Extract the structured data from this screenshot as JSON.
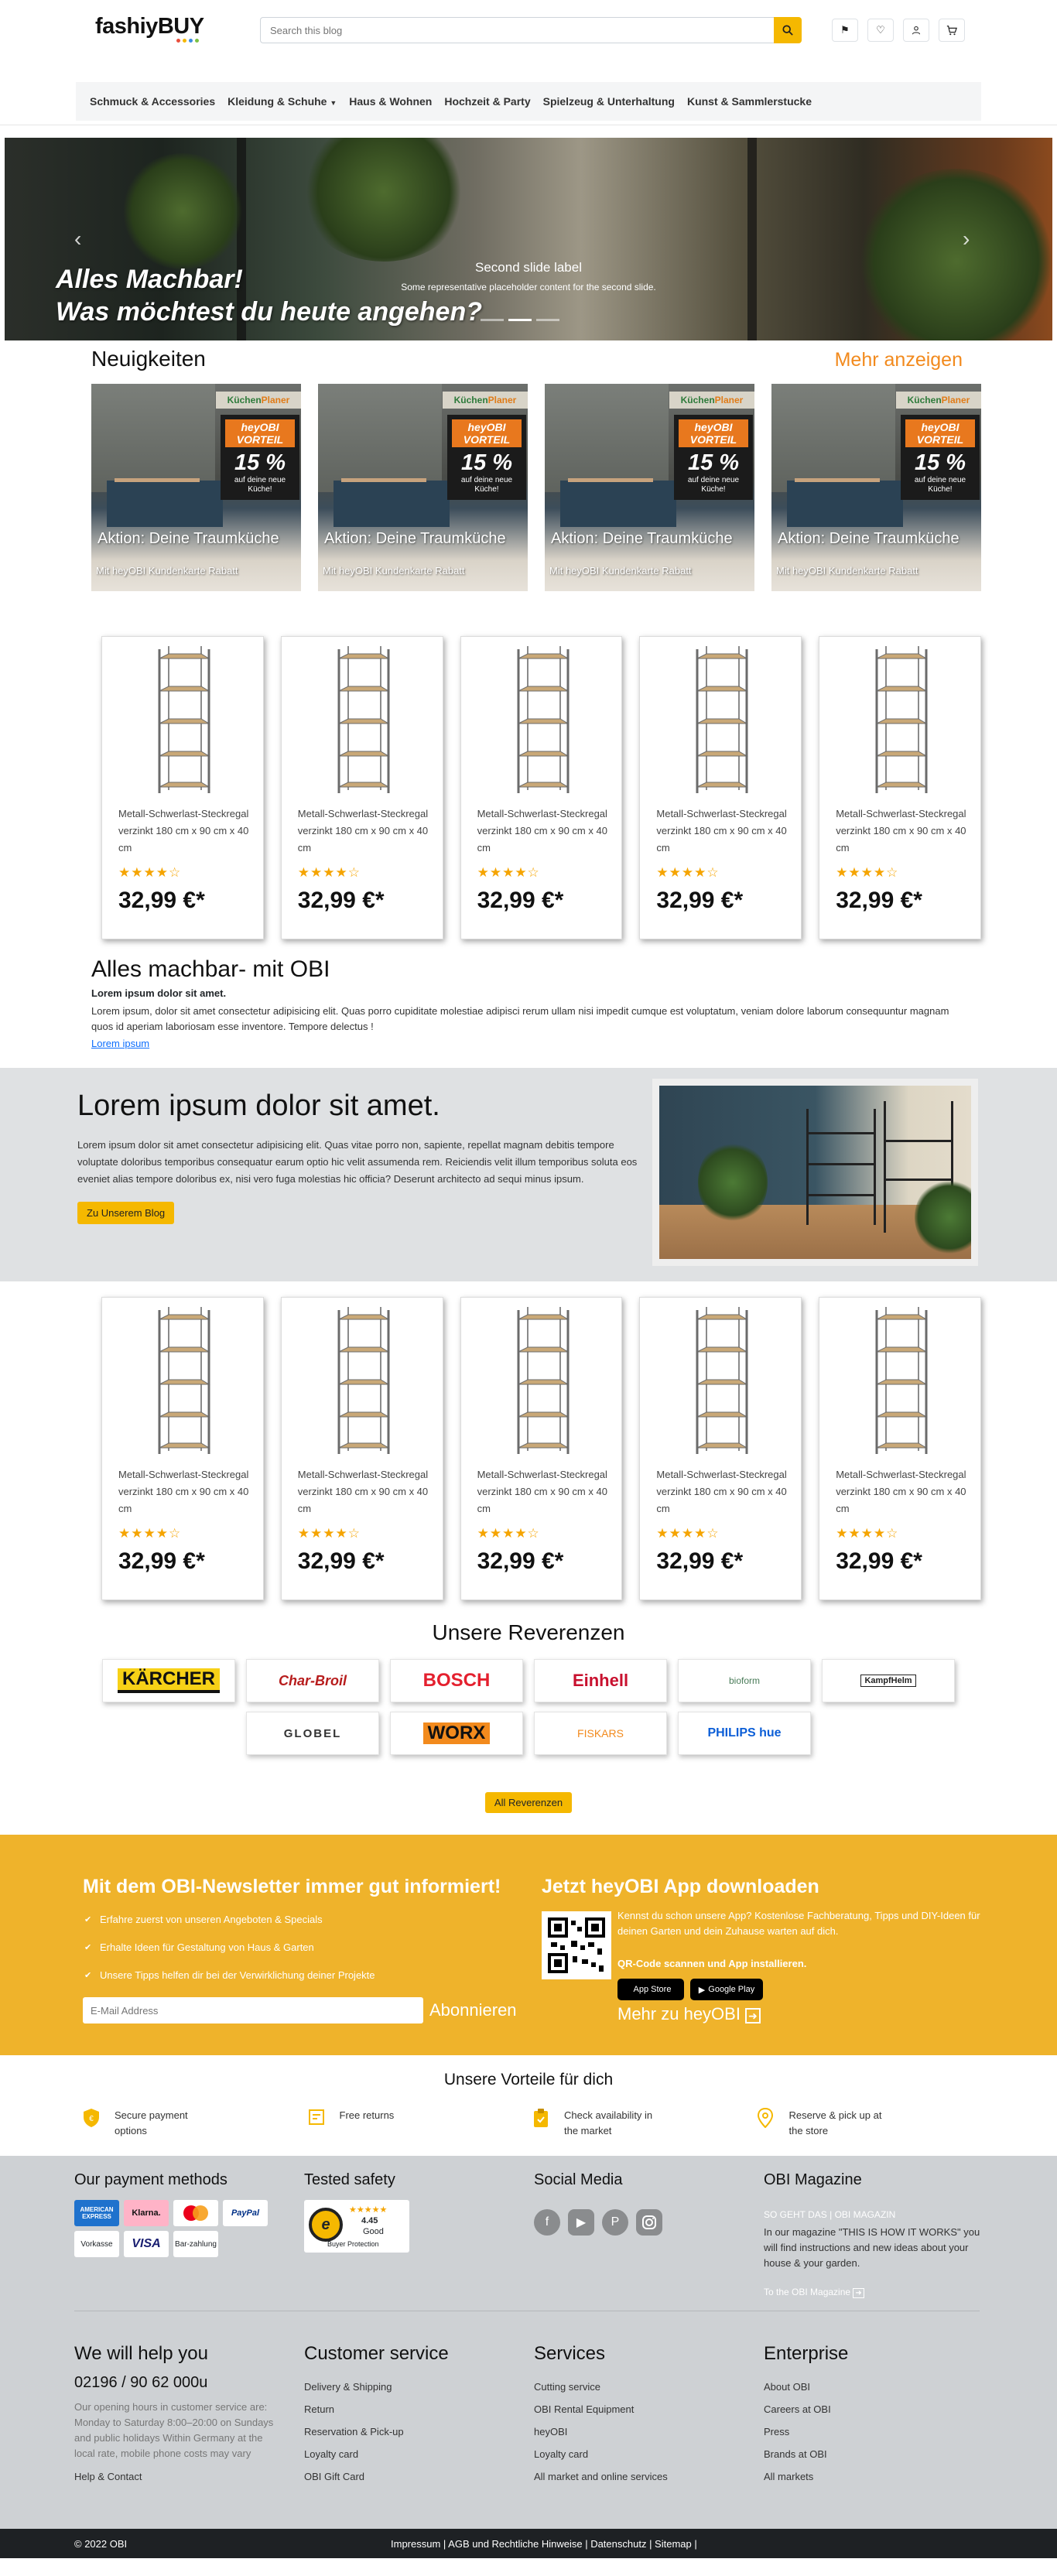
{
  "header": {
    "logo": "fashiyBUY",
    "logo_dot_colors": [
      "#e94e3c",
      "#f5b800",
      "#3a8de0",
      "#7bc043"
    ],
    "search": {
      "placeholder": "Search this blog"
    },
    "icons": [
      "search-icon",
      "flag-icon",
      "heart-icon",
      "user-icon",
      "cart-icon"
    ]
  },
  "nav": {
    "items": [
      "Schmuck & Accessories",
      "Kleidung & Schuhe",
      "Haus & Wohnen",
      "Hochzeit & Party",
      "Spielzeug & Unterhaltung",
      "Kunst & Sammlerstucke"
    ]
  },
  "hero": {
    "title_line1": "Alles Machbar!",
    "title_line2": "Was möchtest du heute angehen?",
    "caption_title": "Second slide label",
    "caption_text": "Some representative placeholder content for the second slide.",
    "slide_count": 3,
    "active_slide": 2
  },
  "news": {
    "title": "Neuigkeiten",
    "more": "Mehr anzeigen",
    "cards": [
      {
        "tag1": "Küchen",
        "tag2": "Planer",
        "badge_a": "heyOBI",
        "badge_b": "VORTEIL",
        "pct": "15 %",
        "badge_small1": "auf deine neue",
        "badge_small2": "Küche!",
        "title": "Aktion: Deine Traumküche",
        "sub": "Mit heyOBI Kundenkarte Rabatt"
      },
      {
        "tag1": "Küchen",
        "tag2": "Planer",
        "badge_a": "heyOBI",
        "badge_b": "VORTEIL",
        "pct": "15 %",
        "badge_small1": "auf deine neue",
        "badge_small2": "Küche!",
        "title": "Aktion: Deine Traumküche",
        "sub": "Mit heyOBI Kundenkarte Rabatt"
      },
      {
        "tag1": "Küchen",
        "tag2": "Planer",
        "badge_a": "heyOBI",
        "badge_b": "VORTEIL",
        "pct": "15 %",
        "badge_small1": "auf deine neue",
        "badge_small2": "Küche!",
        "title": "Aktion: Deine Traumküche",
        "sub": "Mit heyOBI Kundenkarte Rabatt"
      },
      {
        "tag1": "Küchen",
        "tag2": "Planer",
        "badge_a": "heyOBI",
        "badge_b": "VORTEIL",
        "pct": "15 %",
        "badge_small1": "auf deine neue",
        "badge_small2": "Küche!",
        "title": "Aktion: Deine Traumküche",
        "sub": "Mit heyOBI Kundenkarte Rabatt"
      }
    ]
  },
  "products1": [
    {
      "name": "Metall-Schwerlast-Steckregal verzinkt 180 cm x 90 cm x 40 cm",
      "stars": "★★★★☆",
      "rating": 4.5,
      "price": "32,99 €*"
    },
    {
      "name": "Metall-Schwerlast-Steckregal verzinkt 180 cm x 90 cm x 40 cm",
      "stars": "★★★★☆",
      "rating": 4.5,
      "price": "32,99 €*"
    },
    {
      "name": "Metall-Schwerlast-Steckregal verzinkt 180 cm x 90 cm x 40 cm",
      "stars": "★★★★☆",
      "rating": 4.5,
      "price": "32,99 €*"
    },
    {
      "name": "Metall-Schwerlast-Steckregal verzinkt 180 cm x 90 cm x 40 cm",
      "stars": "★★★★☆",
      "rating": 4.5,
      "price": "32,99 €*"
    },
    {
      "name": "Metall-Schwerlast-Steckregal verzinkt 180 cm x 90 cm x 40 cm",
      "stars": "★★★★☆",
      "rating": 4.5,
      "price": "32,99 €*"
    }
  ],
  "intro": {
    "title": "Alles machbar- mit OBI",
    "lead": "Lorem ipsum dolor sit amet.",
    "text": "Lorem ipsum, dolor sit amet consectetur adipisicing elit. Quas porro cupiditate molestiae adipisci rerum ullam nisi impedit cumque est voluptatum, veniam dolore laborum consequuntur magnam quos id aperiam laboriosam esse inventore. Tempore delectus !",
    "link": "Lorem ipsum"
  },
  "blog": {
    "title": "Lorem ipsum dolor sit amet.",
    "text": "Lorem ipsum dolor sit amet consectetur adipisicing elit. Quas vitae porro non, sapiente, repellat magnam debitis tempore voluptate doloribus temporibus consequatur earum optio hic velit assumenda rem. Reiciendis velit illum temporibus soluta eos eveniet alias tempore doloribus ex, nisi vero fuga molestias hic officia? Deserunt architecto ad sequi minus ipsum.",
    "button": "Zu Unserem Blog"
  },
  "products2": [
    {
      "name": "Metall-Schwerlast-Steckregal verzinkt 180 cm x 90 cm x 40 cm",
      "stars": "★★★★☆",
      "rating": 4.5,
      "price": "32,99 €*"
    },
    {
      "name": "Metall-Schwerlast-Steckregal verzinkt 180 cm x 90 cm x 40 cm",
      "stars": "★★★★☆",
      "rating": 4.5,
      "price": "32,99 €*"
    },
    {
      "name": "Metall-Schwerlast-Steckregal verzinkt 180 cm x 90 cm x 40 cm",
      "stars": "★★★★☆",
      "rating": 4.5,
      "price": "32,99 €*"
    },
    {
      "name": "Metall-Schwerlast-Steckregal verzinkt 180 cm x 90 cm x 40 cm",
      "stars": "★★★★☆",
      "rating": 4.5,
      "price": "32,99 €*"
    },
    {
      "name": "Metall-Schwerlast-Steckregal verzinkt 180 cm x 90 cm x 40 cm",
      "stars": "★★★★☆",
      "rating": 4.5,
      "price": "32,99 €*"
    }
  ],
  "brands": {
    "title": "Unsere Reverenzen",
    "row1": [
      "KÄRCHER",
      "Char-Broil",
      "BOSCH",
      "Einhell",
      "bioform",
      "KampfHelm"
    ],
    "row2": [
      "GLOBEL",
      "WORX",
      "FISKARS",
      "PHILIPS hue"
    ],
    "button": "All Reverenzen"
  },
  "newsletter": {
    "title": "Mit dem OBI-Newsletter immer gut informiert!",
    "bullets": [
      "Erfahre zuerst von unseren Angeboten & Specials",
      "Erhalte Ideen für Gestaltung von Haus & Garten",
      "Unsere Tipps helfen dir bei der Verwirklichung deiner Projekte"
    ],
    "placeholder": "E-Mail Address",
    "button": "Abonnieren"
  },
  "app": {
    "title": "Jetzt heyOBI App downloaden",
    "text": "Kennst du schon unsere App? Kostenlose Fachberatung, Tipps und DIY-Ideen für deinen Garten und dein Zuhause warten auf dich.",
    "bold": "QR-Code scannen und App installieren.",
    "appstore": "App Store",
    "googleplay": "Google Play",
    "link": "Mehr zu heyOBI"
  },
  "vorteile": {
    "title": "Unsere Vorteile für dich",
    "items": [
      {
        "icon": "shield-icon",
        "text": "Secure payment options"
      },
      {
        "icon": "box-icon",
        "text": "Free returns"
      },
      {
        "icon": "clipboard-icon",
        "text": "Check availability in the market"
      },
      {
        "icon": "location-icon",
        "text": "Reserve & pick up at the store"
      }
    ]
  },
  "footer": {
    "payment_title": "Our payment methods",
    "payments": [
      "AMERICAN EXPRESS",
      "Klarna.",
      "MC",
      "PayPal",
      "Vorkasse",
      "VISA",
      "Bar-zahlung"
    ],
    "safety_title": "Tested safety",
    "trusted": {
      "score": "4.45",
      "label": "Good",
      "caption": "Buyer Protection",
      "rating": 4.45
    },
    "social_title": "Social Media",
    "social": [
      "facebook-icon",
      "youtube-icon",
      "pinterest-icon",
      "instagram-icon"
    ],
    "mag_title": "OBI Magazine",
    "mag_tag1": "SO GEHT DAS",
    "mag_tag2": "OBI MAGAZIN",
    "mag_text": "In our magazine \"THIS IS HOW IT WORKS\" you will find instructions and new ideas about your house & your garden.",
    "mag_link": "To the OBI Magazine",
    "help_title": "We will help you",
    "phone": "02196 / 90 62 000u",
    "hours": "Our opening hours in customer service are: Monday to Saturday 8:00–20:00 on Sundays and public holidays Within Germany at the local rate, mobile phone costs may vary",
    "help_link": "Help & Contact",
    "cs_title": "Customer service",
    "cs_items": [
      "Delivery & Shipping",
      "Return",
      "Reservation & Pick-up",
      "Loyalty card",
      "OBI Gift Card"
    ],
    "svc_title": "Services",
    "svc_items": [
      "Cutting service",
      "OBI Rental Equipment",
      "heyOBI",
      "Loyalty card",
      "All market and online services"
    ],
    "ent_title": "Enterprise",
    "ent_items": [
      "About OBI",
      "Careers at OBI",
      "Press",
      "Brands at OBI",
      "All markets"
    ]
  },
  "bottombar": {
    "copyright": "© 2022 OBI",
    "links": "Impressum | AGB und Rechtliche Hinweise | Datenschutz | Sitemap |"
  },
  "colors": {
    "accent": "#f5b800",
    "yellow_band": "#efb32b",
    "orange_link": "#f28a1d",
    "footer_bg": "#ced1d4",
    "bottom_bg": "#1e2124"
  }
}
